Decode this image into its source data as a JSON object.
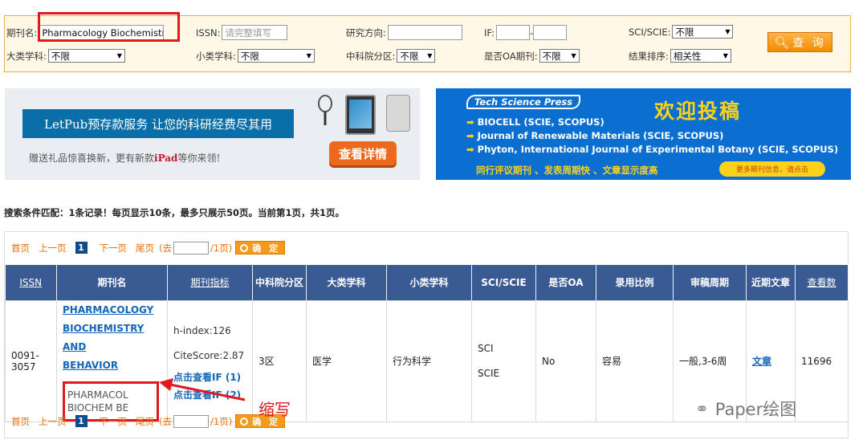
{
  "search": {
    "journal_label": "期刊名:",
    "journal_value": "Pharmacology Biochemistry",
    "issn_label": "ISSN:",
    "issn_placeholder": "请完整填写",
    "direction_label": "研究方向:",
    "if_label": "IF:",
    "if_sep": "-",
    "sci_label": "SCI/SCIE:",
    "sci_value": "不限",
    "major_label": "大类学科:",
    "major_value": "不限",
    "minor_label": "小类学科:",
    "minor_value": "不限",
    "cas_label": "中科院分区:",
    "cas_value": "不限",
    "oa_label": "是否OA期刊:",
    "oa_value": "不限",
    "sort_label": "结果排序:",
    "sort_value": "相关性",
    "query_label": "查 询"
  },
  "banner_left": {
    "title": "LetPub预存款服务 让您的科研经费尽其用",
    "subtitle_pre": "赠送礼品惊喜换新，更有新款",
    "subtitle_bold": "iPad",
    "subtitle_post": "等你来领!",
    "cta": "查看详情"
  },
  "banner_right": {
    "brand": "Tech Science Press",
    "welcome": "欢迎投稿",
    "lines": [
      "BIOCELL (SCIE, SCOPUS)",
      "Journal of Renewable Materials (SCIE, SCOPUS)",
      "Phyton, International Journal of Experimental Botany (SCIE, SCOPUS)"
    ],
    "footer": "同行评议期刊 、发表周期快 、文章显示度高",
    "more": "更多期刊信息，请点击"
  },
  "summary": "搜索条件匹配：1条记录！每页显示10条，最多只展示50页。当前第1页，共1页。",
  "pager": {
    "first": "首页",
    "prev": "上一页",
    "current": "1",
    "next": "下一页",
    "last": "尾页",
    "goto_pre": "(去",
    "goto_post": "/1页)",
    "ok": "确 定"
  },
  "table": {
    "headers": [
      "ISSN",
      "期刊名",
      "期刊指标",
      "中科院分区",
      "大类学科",
      "小类学科",
      "SCI/SCIE",
      "是否OA",
      "录用比例",
      "审稿周期",
      "近期文章",
      "查看数"
    ],
    "row": {
      "issn": "0091-3057",
      "name_lines": [
        "PHARMACOLOGY",
        "BIOCHEMISTRY AND",
        "BEHAVIOR"
      ],
      "abbr": "PHARMACOL BIOCHEM BE",
      "h_index": "h-index:126",
      "citescore": "CiteScore:2.87",
      "if_link1": "点击查看IF (1)",
      "if_link2": "点击查看IF (2)",
      "cas": "3区",
      "major": "医学",
      "minor": "行为科学",
      "sci1": "SCI",
      "sci2": "SCIE",
      "oa": "No",
      "ratio": "容易",
      "review": "一般,3-6周",
      "recent": "文章",
      "views": "11696"
    }
  },
  "annotation": "缩写",
  "watermark": "Paper绘图",
  "colors": {
    "accent": "#f28c00",
    "header_blue": "#3a5a94",
    "link_blue": "#1566b8",
    "highlight_red": "#e0191e"
  }
}
